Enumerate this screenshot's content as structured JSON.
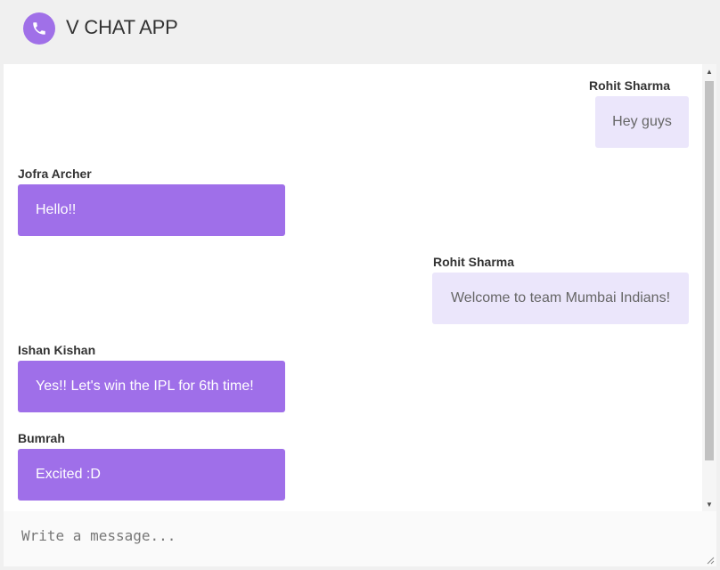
{
  "header": {
    "title": "V CHAT APP",
    "logo_icon": "phone-icon",
    "accent": "#a070e8"
  },
  "messages": [
    {
      "sender": "Rohit Sharma",
      "text": "Hey guys",
      "own": true
    },
    {
      "sender": "Jofra Archer",
      "text": "Hello!!",
      "own": false
    },
    {
      "sender": "Rohit Sharma",
      "text": "Welcome to team Mumbai Indians!",
      "own": true
    },
    {
      "sender": "Ishan Kishan",
      "text": "Yes!! Let's win the IPL for 6th time!",
      "own": false
    },
    {
      "sender": "Bumrah",
      "text": "Excited :D",
      "own": false
    }
  ],
  "composer": {
    "placeholder": "Write a message...",
    "value": ""
  },
  "colors": {
    "own_bubble": "#ebe6fb",
    "other_bubble": "#9f6fe9"
  }
}
